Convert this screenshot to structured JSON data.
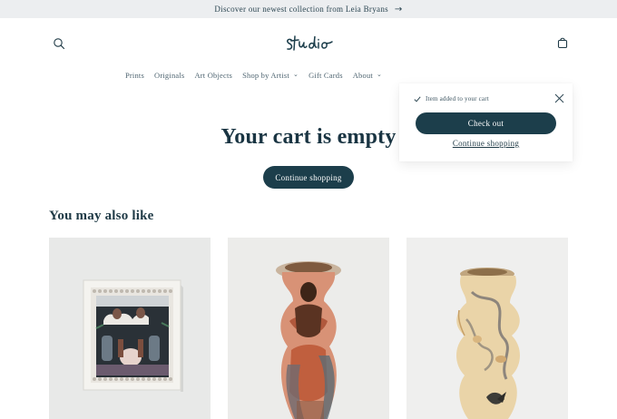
{
  "announcement": {
    "text": "Discover our newest collection from Leia Bryans",
    "arrow": "→"
  },
  "header": {
    "search_icon": "search-icon",
    "cart_icon": "cart-icon"
  },
  "nav": {
    "items": [
      {
        "label": "Prints"
      },
      {
        "label": "Originals"
      },
      {
        "label": "Art Objects"
      },
      {
        "label": "Shop by Artist",
        "chevron": "⌄"
      },
      {
        "label": "Gift Cards"
      },
      {
        "label": "About",
        "chevron": "⌄"
      }
    ]
  },
  "main": {
    "title": "Your cart is empty",
    "continue_label": "Continue shopping",
    "recommendations_heading": "You may also like"
  },
  "popup": {
    "added_text": "Item added to your cart",
    "checkout_label": "Check out",
    "continue_label": "Continue shopping"
  },
  "colors": {
    "accent": "#1c3e4b",
    "announcement_bg": "#eceef0",
    "text": "#1f3a46"
  }
}
